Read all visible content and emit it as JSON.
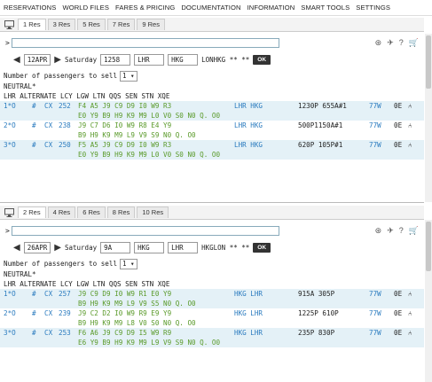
{
  "menu": [
    "RESERVATIONS",
    "WORLD FILES",
    "FARES & PRICING",
    "DOCUMENTATION",
    "INFORMATION",
    "SMART TOOLS",
    "SETTINGS"
  ],
  "pane1": {
    "tabs": [
      "1 Res",
      "3 Res",
      "5 Res",
      "7 Res",
      "9 Res"
    ],
    "prompt": ">",
    "date": "12APR",
    "day": "Saturday",
    "time": "1258",
    "from": "LHR",
    "to": "HKG",
    "cmd": "LONHKG ** **",
    "ok": "OK",
    "pax_label": "Number of passengers to sell",
    "pax_value": "1",
    "neutral": "NEUTRAL*",
    "header": "LHR ALTERNATE LCY LGW LTN QQS SEN STN XQE",
    "flights": [
      {
        "num": "1*O",
        "hash": "#",
        "air": "CX",
        "fno": "252",
        "cls1": "F4 A5 J9 C9 D9 I0 W9 R3",
        "route": "LHR HKG",
        "times": "1230P 655A#1",
        "eq": "77W",
        "misc": "0E",
        "cls2": "E0 Y9 B9 H9 K9 M9 L0 V0 S0 N0 Q. O0"
      },
      {
        "num": "2*O",
        "hash": "#",
        "air": "CX",
        "fno": "238",
        "cls1": "J9 C7 D6 I0 W9 R8 E4 Y9",
        "route": "LHR HKG",
        "times": "500P1150A#1",
        "eq": "77W",
        "misc": "0E",
        "cls2": "B9 H9 K9 M9 L9 V9 S9 N0 Q. O0"
      },
      {
        "num": "3*O",
        "hash": "#",
        "air": "CX",
        "fno": "250",
        "cls1": "F5 A5 J9 C9 D9 I0 W9 R3",
        "route": "LHR HKG",
        "times": "620P 105P#1",
        "eq": "77W",
        "misc": "0E",
        "cls2": "E0 Y9 B9 H9 K9 M9 L0 V0 S0 N0 Q. O0"
      }
    ]
  },
  "pane2": {
    "tabs": [
      "2 Res",
      "4 Res",
      "6 Res",
      "8 Res",
      "10 Res"
    ],
    "prompt": ">",
    "date": "26APR",
    "day": "Saturday",
    "time": "9A",
    "from": "HKG",
    "to": "LHR",
    "cmd": "HKGLON ** **",
    "ok": "OK",
    "pax_label": "Number of passengers to sell",
    "pax_value": "1",
    "neutral": "NEUTRAL*",
    "header": "LHR ALTERNATE LCY LGW LTN QQS SEN STN XQE",
    "flights": [
      {
        "num": "1*O",
        "hash": "#",
        "air": "CX",
        "fno": "257",
        "cls1": "J9 C9 D9 I0 W9 R1 E0 Y9",
        "route": "HKG LHR",
        "times": "915A 305P",
        "eq": "77W",
        "misc": "0E",
        "cls2": "B9 H9 K9 M9 L9 V9 S5 N0 Q. O0"
      },
      {
        "num": "2*O",
        "hash": "#",
        "air": "CX",
        "fno": "239",
        "cls1": "J9 C2 D2 I0 W9 R9 E9 Y9",
        "route": "HKG LHR",
        "times": "1225P 610P",
        "eq": "77W",
        "misc": "0E",
        "cls2": "B9 H9 K9 M9 L8 V0 S0 N0 Q. O0"
      },
      {
        "num": "3*O",
        "hash": "#",
        "air": "CX",
        "fno": "253",
        "cls1": "F6 A6 J9 C9 D9 I5 W9 R9",
        "route": "HKG LHR",
        "times": "235P 830P",
        "eq": "77W",
        "misc": "0E",
        "cls2": "E6 Y9 B9 H9 K9 M9 L9 V9 S9 N0 Q. O0"
      }
    ]
  }
}
